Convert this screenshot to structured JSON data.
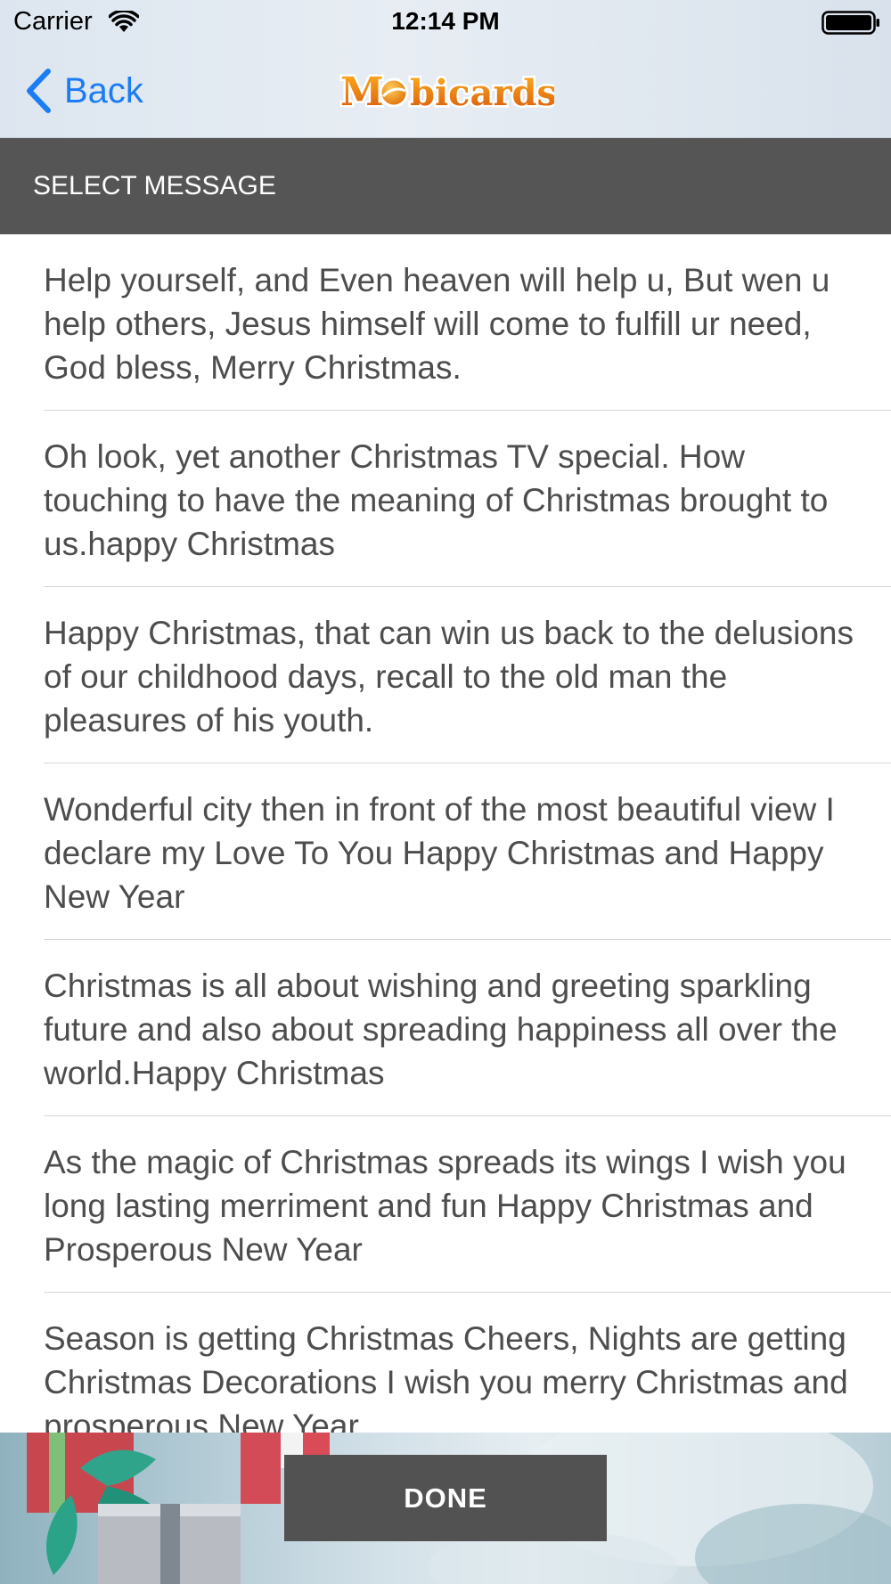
{
  "status_bar": {
    "carrier": "Carrier",
    "time": "12:14 PM",
    "wifi_icon": "wifi-icon",
    "battery_icon": "battery-full-icon"
  },
  "nav": {
    "back_label": "Back",
    "back_icon": "chevron-left-icon",
    "logo_text": "Mobicards",
    "accent_color": "#1b7cf6"
  },
  "section": {
    "title": "SELECT MESSAGE"
  },
  "messages": [
    "Help yourself, and Even heaven will help u, But wen u help others, Jesus himself will come to fulfill ur need, God bless, Merry Christmas.",
    "Oh look, yet another Christmas TV special. How touching to have the meaning of Christmas brought to us.happy Christmas",
    "Happy Christmas, that can win us back to the delusions of our childhood days, recall to the old man the pleasures of his youth.",
    "Wonderful city then in front of the most beautiful view I declare my Love To You Happy Christmas and Happy New Year",
    "Christmas is all about wishing and greeting sparkling future and also about spreading happiness all over the world.Happy Christmas",
    "As the magic of Christmas spreads its wings I wish you long lasting merriment and fun Happy Christmas and Prosperous New Year",
    "Season is getting Christmas Cheers, Nights are getting Christmas Decorations I wish you merry Christmas and prosperous New Year"
  ],
  "footer": {
    "done_label": "DONE",
    "done_color": "#525252"
  },
  "colors": {
    "header_bg": "#555555",
    "separator": "#d6d6d6",
    "message_text": "#4d4d4d"
  }
}
